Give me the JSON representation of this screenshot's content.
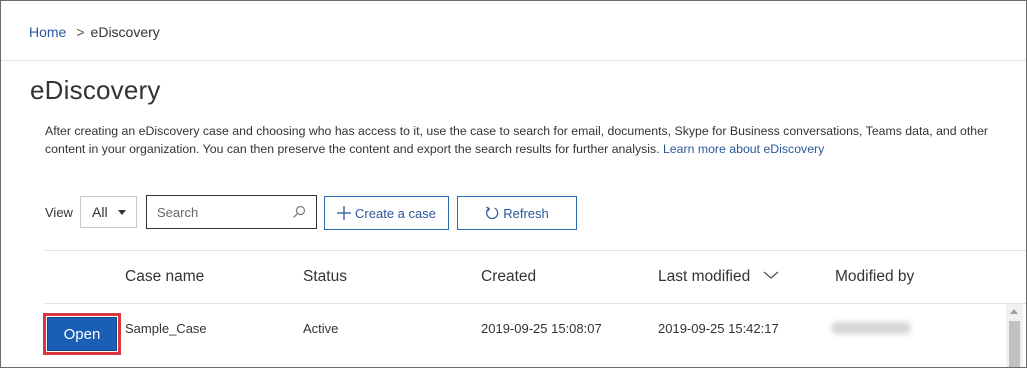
{
  "breadcrumb": {
    "home": "Home",
    "separator": ">",
    "current": "eDiscovery"
  },
  "page": {
    "title": "eDiscovery",
    "description": "After creating an eDiscovery case and choosing who has access to it, use the case to search for email, documents, Skype for Business conversations, Teams data, and other content in your organization. You can then preserve the content and export the search results for further analysis.",
    "learn_more": "Learn more about eDiscovery"
  },
  "toolbar": {
    "view_label": "View",
    "view_value": "All",
    "search_placeholder": "Search",
    "create_label": "Create a case",
    "refresh_label": "Refresh"
  },
  "table": {
    "columns": [
      "Case name",
      "Status",
      "Created",
      "Last modified",
      "Modified by"
    ],
    "sorted_column": "Last modified",
    "rows": [
      {
        "action": "Open",
        "case_name": "Sample_Case",
        "status": "Active",
        "created": "2019-09-25 15:08:07",
        "last_modified": "2019-09-25 15:42:17"
      }
    ]
  },
  "colors": {
    "link": "#2b579a",
    "primary_button": "#1a5fb4",
    "highlight": "#d9363e"
  }
}
